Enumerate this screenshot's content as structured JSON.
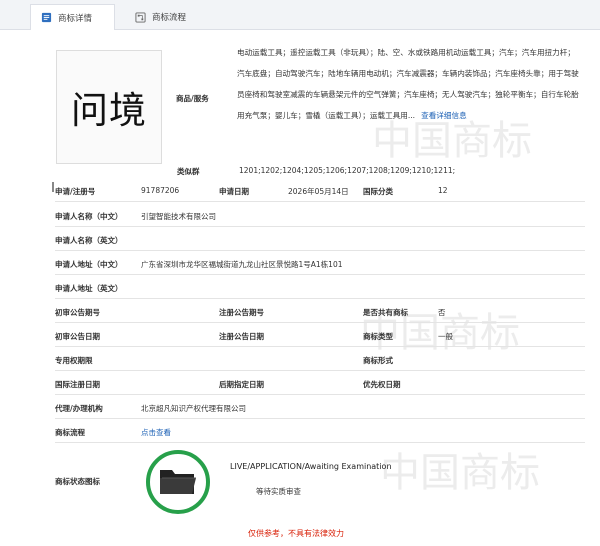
{
  "tabs": [
    {
      "label": "商标详情",
      "icon": "document-icon",
      "active": true
    },
    {
      "label": "商标流程",
      "icon": "flow-icon",
      "active": false
    }
  ],
  "watermark": "中国商标",
  "mark": {
    "text": "问境"
  },
  "goods": {
    "label": "商品/服务",
    "text": "电动运载工具；遥控运载工具（非玩具）；陆、空、水或铁路用机动运载工具；汽车；汽车用扭力杆；汽车底盘；自动驾驶汽车；陆地车辆用电动机；汽车减震器；车辆内装饰品；汽车座椅头靠；用于驾驶员座椅和驾驶室减震的车辆悬架元件的空气弹簧；汽车座椅；无人驾驶汽车；独轮平衡车；自行车轮胎用充气泵；婴儿车；雪橇（运载工具）；运载工具用...",
    "detail_link": "查看详细信息"
  },
  "fields": {
    "similar_group": {
      "label": "类似群",
      "value": "1201;1202;1204;1205;1206;1207;1208;1209;1210;1211;"
    },
    "reg_no": {
      "label": "申请/注册号",
      "value": "91787206"
    },
    "app_date": {
      "label": "申请日期",
      "value": "2026年05月14日"
    },
    "intl_class": {
      "label": "国际分类",
      "value": "12"
    },
    "applicant_cn": {
      "label": "申请人名称（中文）",
      "value": "引望智能技术有限公司"
    },
    "applicant_en": {
      "label": "申请人名称（英文）",
      "value": ""
    },
    "address_cn": {
      "label": "申请人地址（中文）",
      "value": "广东省深圳市龙华区福城街道九龙山社区景悦路1号A1栋101"
    },
    "address_en": {
      "label": "申请人地址（英文）",
      "value": ""
    },
    "prelim_issue": {
      "label": "初审公告期号",
      "value": ""
    },
    "reg_issue": {
      "label": "注册公告期号",
      "value": ""
    },
    "shared": {
      "label": "是否共有商标",
      "value": "否"
    },
    "prelim_date": {
      "label": "初审公告日期",
      "value": ""
    },
    "reg_date": {
      "label": "注册公告日期",
      "value": ""
    },
    "mark_type": {
      "label": "商标类型",
      "value": "一般"
    },
    "exclusive_period": {
      "label": "专用权期限",
      "value": ""
    },
    "mark_form": {
      "label": "商标形式",
      "value": ""
    },
    "intl_reg_date": {
      "label": "国际注册日期",
      "value": ""
    },
    "later_date": {
      "label": "后期指定日期",
      "value": ""
    },
    "priority_date": {
      "label": "优先权日期",
      "value": ""
    },
    "agent": {
      "label": "代理/办理机构",
      "value": "北京超凡知识产权代理有限公司"
    },
    "process": {
      "label": "商标流程",
      "value": "点击查看"
    },
    "status_icon": {
      "label": "商标状态图标",
      "value": ""
    }
  },
  "status": {
    "en": "LIVE/APPLICATION/Awaiting Examination",
    "cn": "等待实质审查",
    "icon": "folder-icon",
    "ring_color": "#27a04a"
  },
  "disclaimer": "仅供参考，不具有法律效力",
  "colors": {
    "link": "#1a5fb4",
    "disclaimer": "#d81e06"
  }
}
